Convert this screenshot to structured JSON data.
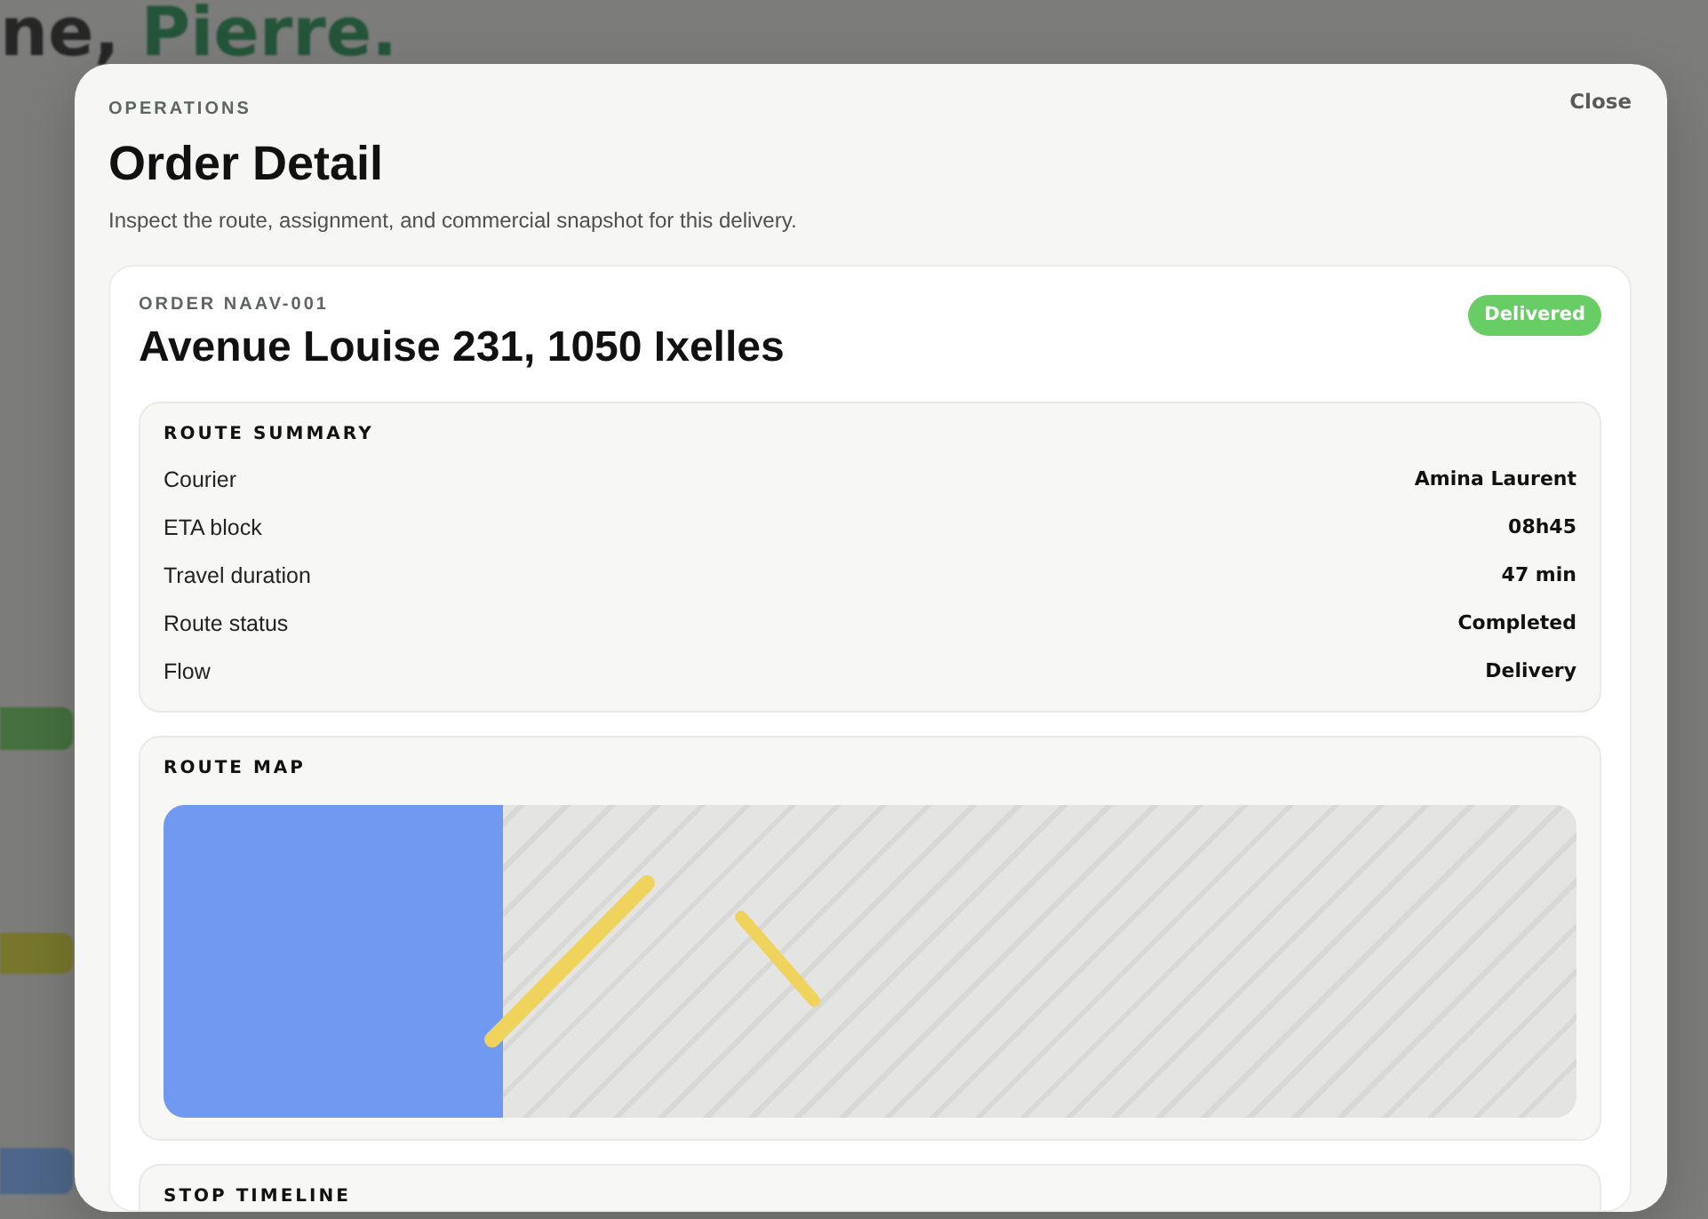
{
  "backdrop": {
    "greeting": "ne,",
    "name": "Pierre."
  },
  "modal": {
    "eyebrow": "OPERATIONS",
    "title": "Order Detail",
    "subtitle": "Inspect the route, assignment, and commercial snapshot for this delivery.",
    "close": "Close"
  },
  "order": {
    "label": "ORDER NAAV-001",
    "address": "Avenue Louise 231, 1050 Ixelles",
    "status": "Delivered"
  },
  "sections": [
    {
      "kind": "summary",
      "title": "ROUTE SUMMARY",
      "rows": [
        {
          "label": "Courier",
          "value": "Amina Laurent"
        },
        {
          "label": "ETA block",
          "value": "08h45"
        },
        {
          "label": "Travel duration",
          "value": "47 min"
        },
        {
          "label": "Route status",
          "value": "Completed"
        },
        {
          "label": "Flow",
          "value": "Delivery"
        }
      ]
    },
    {
      "kind": "map",
      "title": "ROUTE MAP"
    },
    {
      "kind": "timeline",
      "title": "STOP TIMELINE"
    }
  ]
}
